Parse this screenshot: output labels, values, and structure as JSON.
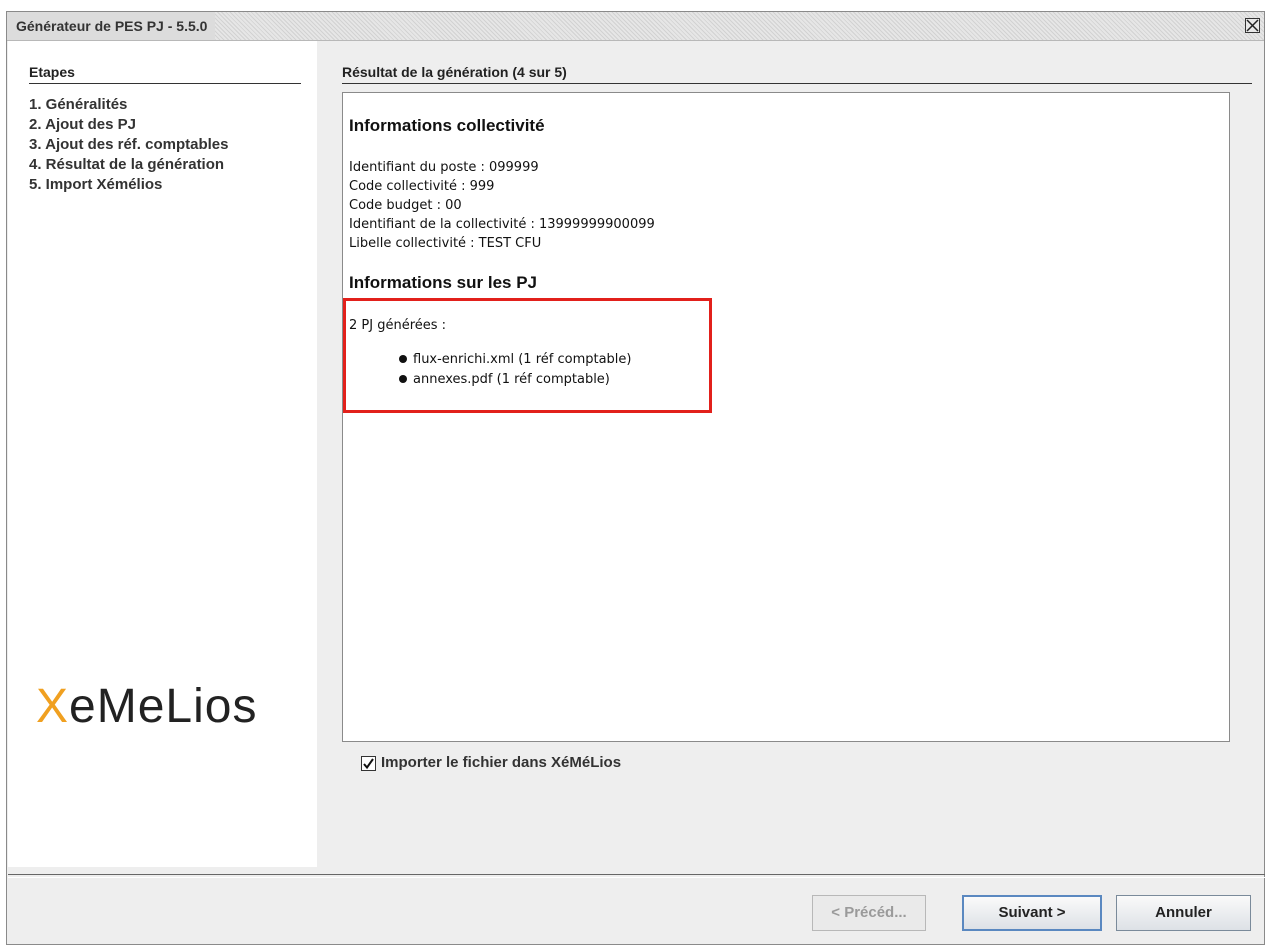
{
  "window": {
    "title": "Générateur de PES PJ - 5.5.0"
  },
  "sidebar": {
    "title": "Etapes",
    "steps": [
      {
        "label": "1. Généralités"
      },
      {
        "label": "2. Ajout des PJ"
      },
      {
        "label": "3. Ajout des réf. comptables"
      },
      {
        "label": "4. Résultat de la génération"
      },
      {
        "label": "5. Import Xémélios"
      }
    ],
    "logo": {
      "x": "X",
      "rest": "eMeLios"
    }
  },
  "main": {
    "title": "Résultat de la génération (4 sur 5)",
    "collectivite": {
      "heading": "Informations collectivité",
      "lines": [
        "Identifiant du poste : 099999",
        "Code collectivité : 999",
        "Code budget : 00",
        "Identifiant de la collectivité : 13999999900099",
        "Libelle collectivité : TEST CFU"
      ]
    },
    "pj": {
      "heading": "Informations sur les PJ",
      "count_text": "2 PJ générées :",
      "items": [
        "flux-enrichi.xml (1 réf comptable)",
        "annexes.pdf (1 réf comptable)"
      ]
    },
    "import_checkbox": {
      "label": "Importer le fichier dans XéMéLios",
      "checked": true
    }
  },
  "buttons": {
    "previous": "< Précéd...",
    "next": "Suivant >",
    "cancel": "Annuler"
  }
}
